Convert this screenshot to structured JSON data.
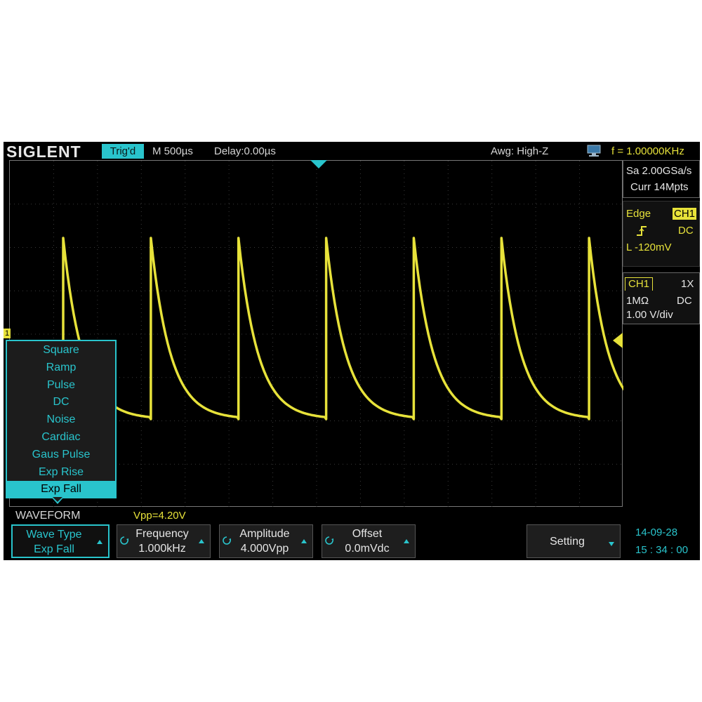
{
  "topbar": {
    "brand": "SIGLENT",
    "trigger_status": "Trig'd",
    "timebase": "M 500µs",
    "delay": "Delay:0.00µs",
    "awg_load": "Awg: High-Z",
    "frequency": "f = 1.00000KHz"
  },
  "acquisition": {
    "sample_rate": "Sa 2.00GSa/s",
    "memory": "Curr 14Mpts"
  },
  "trigger": {
    "type": "Edge",
    "source": "CH1",
    "slope_icon": "rising-edge-icon",
    "coupling": "DC",
    "level": "L  -120mV"
  },
  "channel": {
    "name": "CH1",
    "probe": "1X",
    "impedance": "1MΩ",
    "coupling": "DC",
    "scale": "1.00 V/div",
    "marker": "1"
  },
  "waveform_menu": {
    "items": [
      "Square",
      "Ramp",
      "Pulse",
      "DC",
      "Noise",
      "Cardiac",
      "Gaus Pulse",
      "Exp Rise",
      "Exp Fall"
    ],
    "selected": "Exp Fall"
  },
  "bottom": {
    "menu_title": "WAVEFORM",
    "vpp": "Vpp=4.20V",
    "softkeys": [
      {
        "line1": "Wave Type",
        "line2": "Exp Fall"
      },
      {
        "line1": "Frequency",
        "line2": "1.000kHz"
      },
      {
        "line1": "Amplitude",
        "line2": "4.000Vpp"
      },
      {
        "line1": "Offset",
        "line2": "0.0mVdc"
      },
      {
        "line1": "Setting",
        "line2": ""
      }
    ],
    "date": "14-09-28",
    "time": "15 : 34 : 00"
  },
  "colors": {
    "trace": "#e7e23a",
    "accent": "#29c4cc",
    "background": "#000000"
  }
}
